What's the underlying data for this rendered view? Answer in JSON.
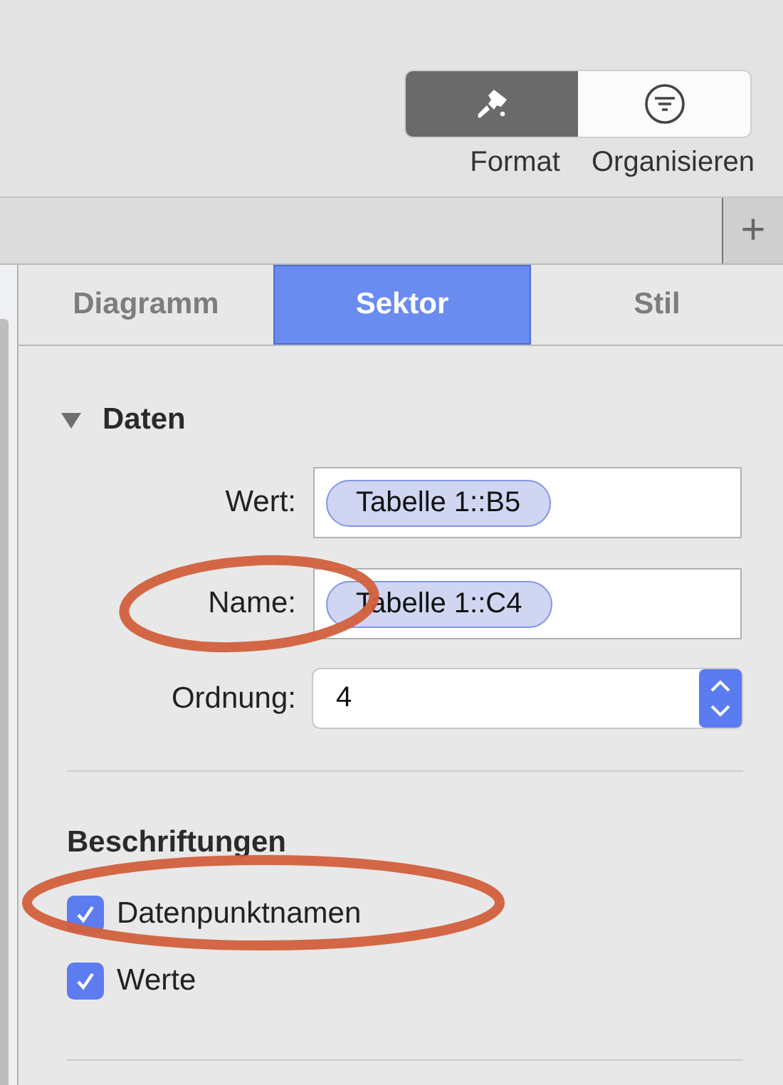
{
  "toolbar": {
    "buttons": [
      {
        "label": "Format",
        "selected": true
      },
      {
        "label": "Organisieren",
        "selected": false
      }
    ]
  },
  "add_button": {
    "label": "+"
  },
  "tabs": [
    {
      "label": "Diagramm",
      "selected": false
    },
    {
      "label": "Sektor",
      "selected": true
    },
    {
      "label": "Stil",
      "selected": false
    }
  ],
  "section": {
    "title": "Daten",
    "expanded": true,
    "fields": [
      {
        "kind": "token",
        "label": "Wert:",
        "value": "Tabelle 1::B5",
        "circled": false
      },
      {
        "kind": "token",
        "label": "Name:",
        "value": "Tabelle 1::C4",
        "circled": true
      },
      {
        "kind": "stepper",
        "label": "Ordnung:",
        "value": "4",
        "circled": false
      }
    ]
  },
  "labels": {
    "title": "Beschriftungen",
    "checkboxes": [
      {
        "label": "Datenpunktnamen",
        "checked": true,
        "circled": true
      },
      {
        "label": "Werte",
        "checked": true,
        "circled": false
      }
    ]
  }
}
